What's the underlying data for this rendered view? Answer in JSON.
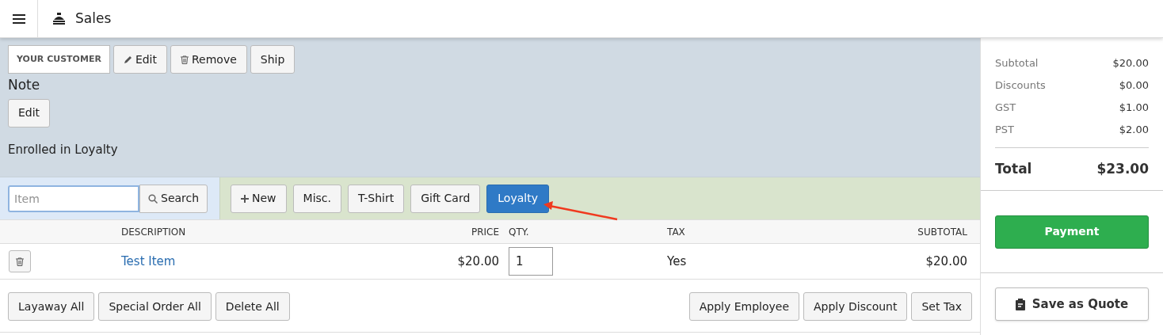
{
  "header": {
    "title": "Sales"
  },
  "customer": {
    "label": "YOUR CUSTOMER",
    "buttons": [
      "Edit",
      "Remove",
      "Ship"
    ],
    "note_title": "Note",
    "note_button": "Edit",
    "loyalty_text": "Enrolled in Loyalty"
  },
  "search": {
    "placeholder": "Item",
    "button": "Search"
  },
  "quick_buttons": [
    {
      "label": "New",
      "highlighted": false
    },
    {
      "label": "Misc.",
      "highlighted": false
    },
    {
      "label": "T-Shirt",
      "highlighted": false
    },
    {
      "label": "Gift Card",
      "highlighted": false
    },
    {
      "label": "Loyalty",
      "highlighted": true
    }
  ],
  "table": {
    "columns": [
      "DESCRIPTION",
      "PRICE",
      "QTY.",
      "TAX",
      "SUBTOTAL"
    ],
    "rows": [
      {
        "description": "Test Item",
        "price": "$20.00",
        "qty": "1",
        "tax": "Yes",
        "subtotal": "$20.00"
      }
    ]
  },
  "left_actions": [
    "Layaway All",
    "Special Order All",
    "Delete All"
  ],
  "right_actions": [
    "Apply Employee",
    "Apply Discount",
    "Set Tax"
  ],
  "totals": [
    {
      "label": "Subtotal",
      "value": "$20.00"
    },
    {
      "label": "Discounts",
      "value": "$0.00"
    },
    {
      "label": "GST",
      "value": "$1.00"
    },
    {
      "label": "PST",
      "value": "$2.00"
    }
  ],
  "total": {
    "label": "Total",
    "value": "$23.00"
  },
  "payment_button": "Payment",
  "quote_button": "Save as Quote"
}
